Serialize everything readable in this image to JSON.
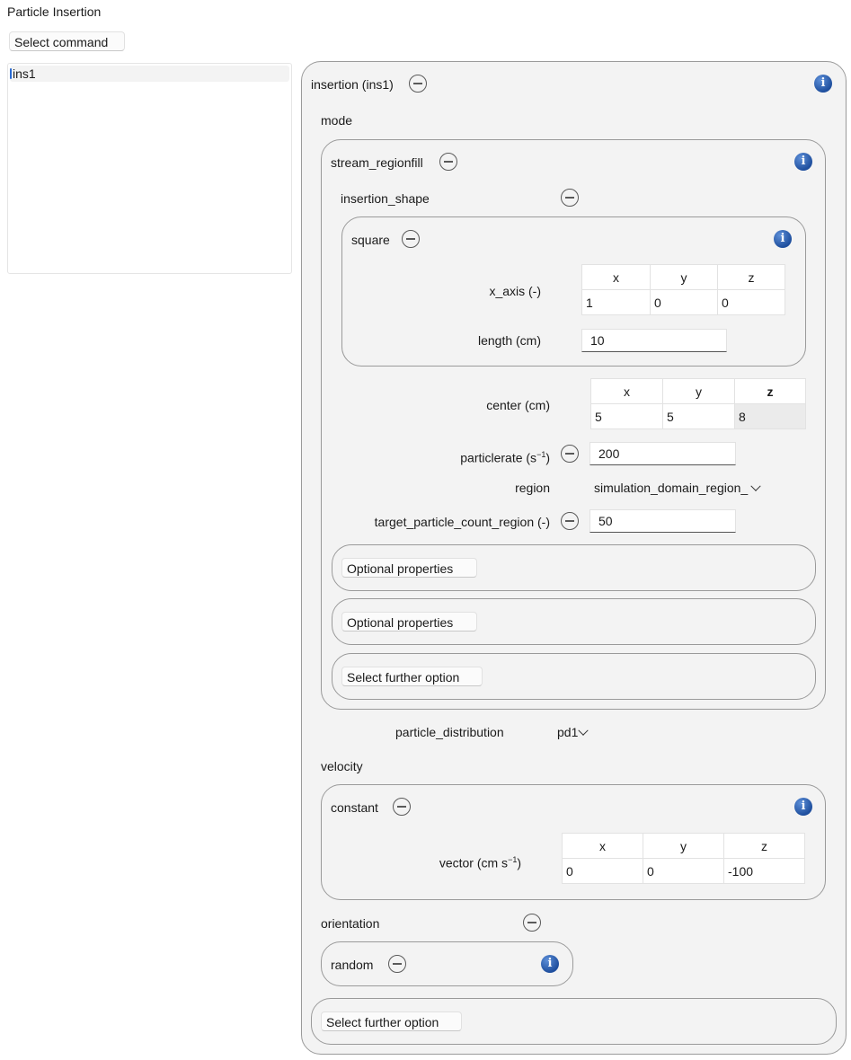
{
  "window": {
    "title": "Particle Insertion"
  },
  "toolbar": {
    "select_command": "Select command"
  },
  "command_list": {
    "items": [
      "ins1"
    ]
  },
  "insertion": {
    "title": "insertion (ins1)",
    "mode_label": "mode",
    "mode": {
      "title": "stream_regionfill",
      "insertion_shape_label": "insertion_shape",
      "shape": {
        "title": "square",
        "x_axis": {
          "label": "x_axis (-)",
          "headers": [
            "x",
            "y",
            "z"
          ],
          "values": [
            "1",
            "0",
            "0"
          ]
        },
        "length": {
          "label": "length (cm)",
          "value": "10"
        }
      },
      "center": {
        "label": "center (cm)",
        "headers": [
          "x",
          "y",
          "z"
        ],
        "values": [
          "5",
          "5",
          "8"
        ]
      },
      "particlerate": {
        "label": "particlerate (s",
        "sup": "−1",
        "close": ")",
        "value": "200"
      },
      "region": {
        "label": "region",
        "value": "simulation_domain_region_"
      },
      "target_count": {
        "label": "target_particle_count_region (-)",
        "value": "50"
      },
      "optional_1": "Optional properties",
      "optional_2": "Optional properties",
      "further": "Select further option"
    },
    "particle_distribution": {
      "label": "particle_distribution",
      "value": "pd1"
    },
    "velocity_label": "velocity",
    "velocity": {
      "title": "constant",
      "vector": {
        "label": "vector (cm s",
        "sup": "−1",
        "close": ")",
        "headers": [
          "x",
          "y",
          "z"
        ],
        "values": [
          "0",
          "0",
          "-100"
        ]
      }
    },
    "orientation_label": "orientation",
    "orientation": {
      "title": "random"
    },
    "further": "Select further option"
  },
  "icons": {
    "info": "info-icon",
    "collapse": "minus-circle-icon",
    "dropdown": "chevron-down-icon"
  },
  "colors": {
    "panel_bg": "#f3f3f3",
    "panel_border": "#9a9a9a",
    "info_blue": "#1f4f9e",
    "selection_accent": "#2b6cd4"
  }
}
